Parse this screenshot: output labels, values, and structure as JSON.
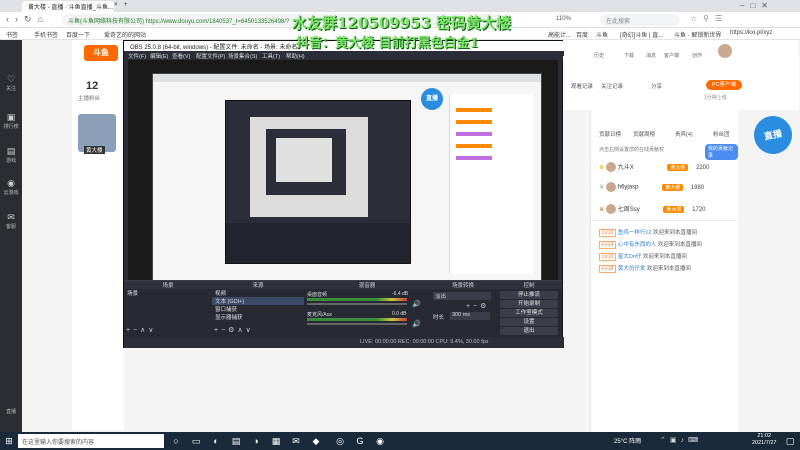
{
  "browser": {
    "tabs": [
      "黄大楼 - 直播 · 斗鱼直播_斗鱼...",
      "×",
      "+"
    ],
    "url": "斗鱼(斗鱼网络科技有限公司)  https://www.douyu.com/1840537_t=6450133526498/?",
    "zoom": "110%",
    "bookmarks": [
      "书签",
      "手机书签",
      "百度一下",
      "爱奇艺的的网站",
      "高能计...",
      "百度",
      "斗鱼",
      "[奇幻]斗鱼 | 直...",
      "斗鱼 · 解锁新世界",
      "https://kxi.pl/xyz"
    ],
    "right_bar": "在此搜索"
  },
  "overlay": {
    "line1": "水友群120509953 密码黄大楼",
    "line2": "抖音：黄大楼  目前打黑色白金1"
  },
  "sidebar": {
    "items": [
      {
        "icon": "♡",
        "label": "关注"
      },
      {
        "icon": "▣",
        "label": "排行榜"
      },
      {
        "icon": "▤",
        "label": "游戏"
      },
      {
        "icon": "◉",
        "label": "云游戏"
      },
      {
        "icon": "✉",
        "label": "客服"
      }
    ],
    "bottom": "直播"
  },
  "douyu": {
    "logo": "斗鱼",
    "follow_count": "12",
    "follow_label": "主播粉丝",
    "streamer_tag": "黄大楼",
    "header_icons": [
      "历史",
      "下载",
      "消息",
      "客户端",
      "创作"
    ],
    "pc_btn": "PC客户端",
    "right_icons": [
      "观看记录",
      "关注记录",
      "分享"
    ],
    "right_labels": [
      "客户端",
      "1分钟上线"
    ],
    "promo": "直播"
  },
  "obs": {
    "title": "OBS 25.0.8 (64-bit, windows) - 配置文件: 未命名 - 场景: 未命名",
    "menu": [
      "文件(F)",
      "编辑(E)",
      "查看(V)",
      "配置文件(P)",
      "场景集合(S)",
      "工具(T)",
      "帮助(H)"
    ],
    "docks": {
      "scenes": {
        "title": "场景",
        "items": [
          "场景"
        ]
      },
      "sources": {
        "title": "来源",
        "items": [
          "视频",
          "文本 (GDI+)",
          "窗口捕获",
          "显示器捕获"
        ]
      },
      "mixer": {
        "title": "混音器",
        "items": [
          "桌面音频",
          "麦克风/Aux"
        ],
        "levels": [
          "-6.4 dB",
          "0.0 dB"
        ]
      },
      "transitions": {
        "title": "场景转换",
        "type": "淡出",
        "duration_label": "时长",
        "duration": "300 ms"
      },
      "controls": {
        "title": "控制",
        "buttons": [
          "停止推流",
          "开始录制",
          "工作室模式",
          "设置",
          "退出"
        ]
      }
    },
    "status": "LIVE: 00:00:00  REC: 00:00:00  CPU: 9.4%, 30.00 fps"
  },
  "right_panel": {
    "tabs": [
      "贡献日榜",
      "贡献周榜",
      "贵宾(4)",
      "粉丝团"
    ],
    "notice": "点击右侧设置您的在线贡献权",
    "btn": "我的贡献记录",
    "ranks": [
      {
        "name": "九斗X",
        "badge": "黄大楼",
        "score": "2200"
      },
      {
        "name": "h6yjasp",
        "badge": "黄大楼",
        "score": "1980"
      },
      {
        "name": "七周Ssy",
        "badge": "黄大楼",
        "score": "1720"
      }
    ],
    "chat": [
      {
        "lvl": "LV10",
        "user": "鱼鸡一样行12",
        "msg": "欢迎来到本直播间"
      },
      {
        "lvl": "LV14",
        "user": "心中有东西的人",
        "msg": "欢迎来到本直播间"
      },
      {
        "lvl": "LV10",
        "user": "星大Dn仔",
        "msg": "欢迎来到本直播间"
      },
      {
        "lvl": "LV18",
        "user": "黄大仿仔发",
        "msg": "欢迎来到本直播间"
      }
    ]
  },
  "taskbar": {
    "search_placeholder": "在这里输入你要搜索的内容",
    "weather": "25°C 阵雨",
    "time": "21:02",
    "date": "2021/7/27"
  }
}
